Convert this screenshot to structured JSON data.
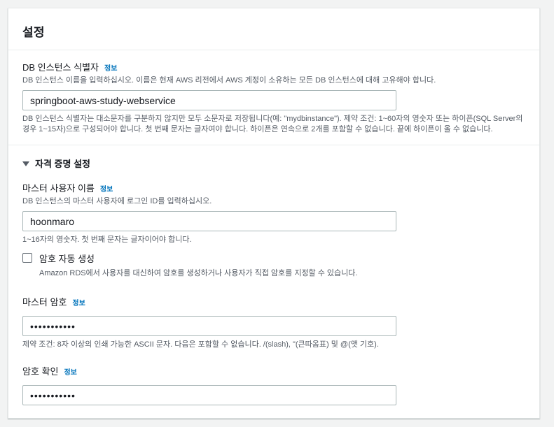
{
  "settings": {
    "title": "설정",
    "db_identifier": {
      "label": "DB 인스턴스 식별자",
      "info": "정보",
      "description": "DB 인스턴스 이름을 입력하십시오. 이름은 현재 AWS 리전에서 AWS 계정이 소유하는 모든 DB 인스턴스에 대해 고유해야 합니다.",
      "value": "springboot-aws-study-webservice",
      "constraint": "DB 인스턴스 식별자는 대소문자를 구분하지 않지만 모두 소문자로 저장됩니다(예: \"mydbinstance\"). 제약 조건: 1~60자의 영숫자 또는 하이픈(SQL Server의 경우 1~15자)으로 구성되어야 합니다. 첫 번째 문자는 글자여야 합니다. 하이픈은 연속으로 2개를 포함할 수 없습니다. 끝에 하이픈이 올 수 없습니다."
    },
    "credentials": {
      "section_label": "자격 증명 설정",
      "master_username": {
        "label": "마스터 사용자 이름",
        "info": "정보",
        "description": "DB 인스턴스의 마스터 사용자에 로그인 ID를 입력하십시오.",
        "value": "hoonmaro",
        "constraint": "1~16자의 영숫자. 첫 번째 문자는 글자이어야 합니다."
      },
      "auto_password": {
        "label": "암호 자동 생성",
        "description": "Amazon RDS에서 사용자를 대신하여 암호를 생성하거나 사용자가 직접 암호를 지정할 수 있습니다.",
        "checked": false
      },
      "master_password": {
        "label": "마스터 암호",
        "info": "정보",
        "value": "•••••••••••",
        "constraint": "제약 조건: 8자 이상의 인쇄 가능한 ASCII 문자. 다음은 포함할 수 없습니다. /(slash), \"(큰따옴표) 및 @(앳 기호)."
      },
      "confirm_password": {
        "label": "암호 확인",
        "info": "정보",
        "value": "•••••••••••"
      }
    }
  },
  "colors": {
    "link": "#0073bb",
    "text": "#16191f",
    "muted": "#545b64",
    "background": "#f2f3f3"
  }
}
